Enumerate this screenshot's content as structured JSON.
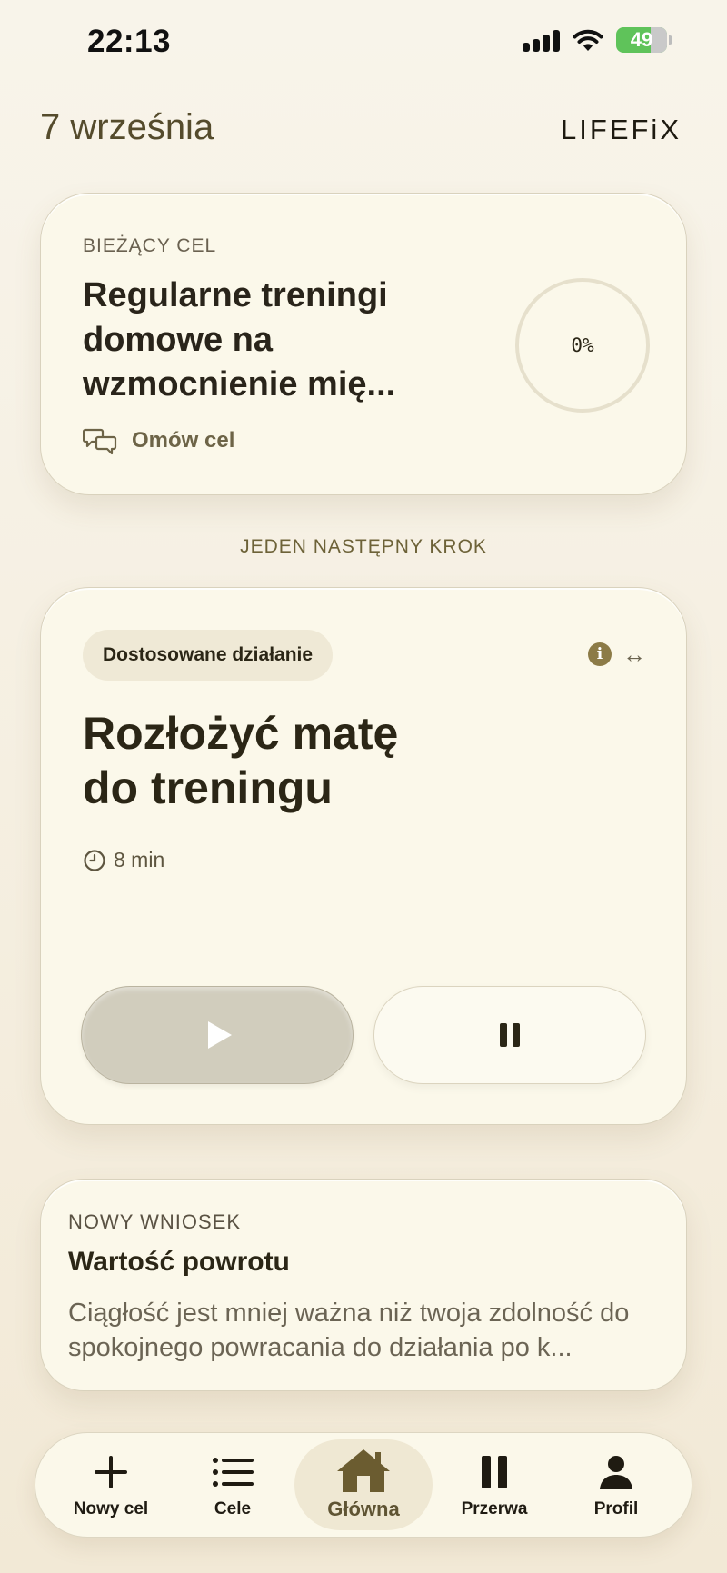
{
  "status_bar": {
    "time": "22:13",
    "battery": "49"
  },
  "header": {
    "date": "7 września",
    "brand": "LIFEFiX"
  },
  "current_goal": {
    "eyebrow": "BIEŻĄCY CEL",
    "title": "Regularne treningi domowe na wzmocnienie mię...",
    "progress": "0%",
    "discuss_label": "Omów cel"
  },
  "next_step": {
    "section_label": "JEDEN NASTĘPNY KROK",
    "tag": "Dostosowane działanie",
    "title_line1": "Rozłożyć matę",
    "title_line2": "do treningu",
    "duration": "8 min"
  },
  "insight": {
    "eyebrow": "NOWY WNIOSEK",
    "title": "Wartość powrotu",
    "body": "Ciągłość jest mniej ważna niż twoja zdolność do spokojnego powracania do działania po k..."
  },
  "tabs": [
    {
      "label": "Nowy cel",
      "icon": "plus-icon"
    },
    {
      "label": "Cele",
      "icon": "list-icon"
    },
    {
      "label": "Główna",
      "icon": "home-icon",
      "active": true
    },
    {
      "label": "Przerwa",
      "icon": "pause-icon"
    },
    {
      "label": "Profil",
      "icon": "person-icon"
    }
  ],
  "colors": {
    "accent": "#8c7b47",
    "battery": "#5fc35a",
    "background": "#f6f0e2"
  }
}
